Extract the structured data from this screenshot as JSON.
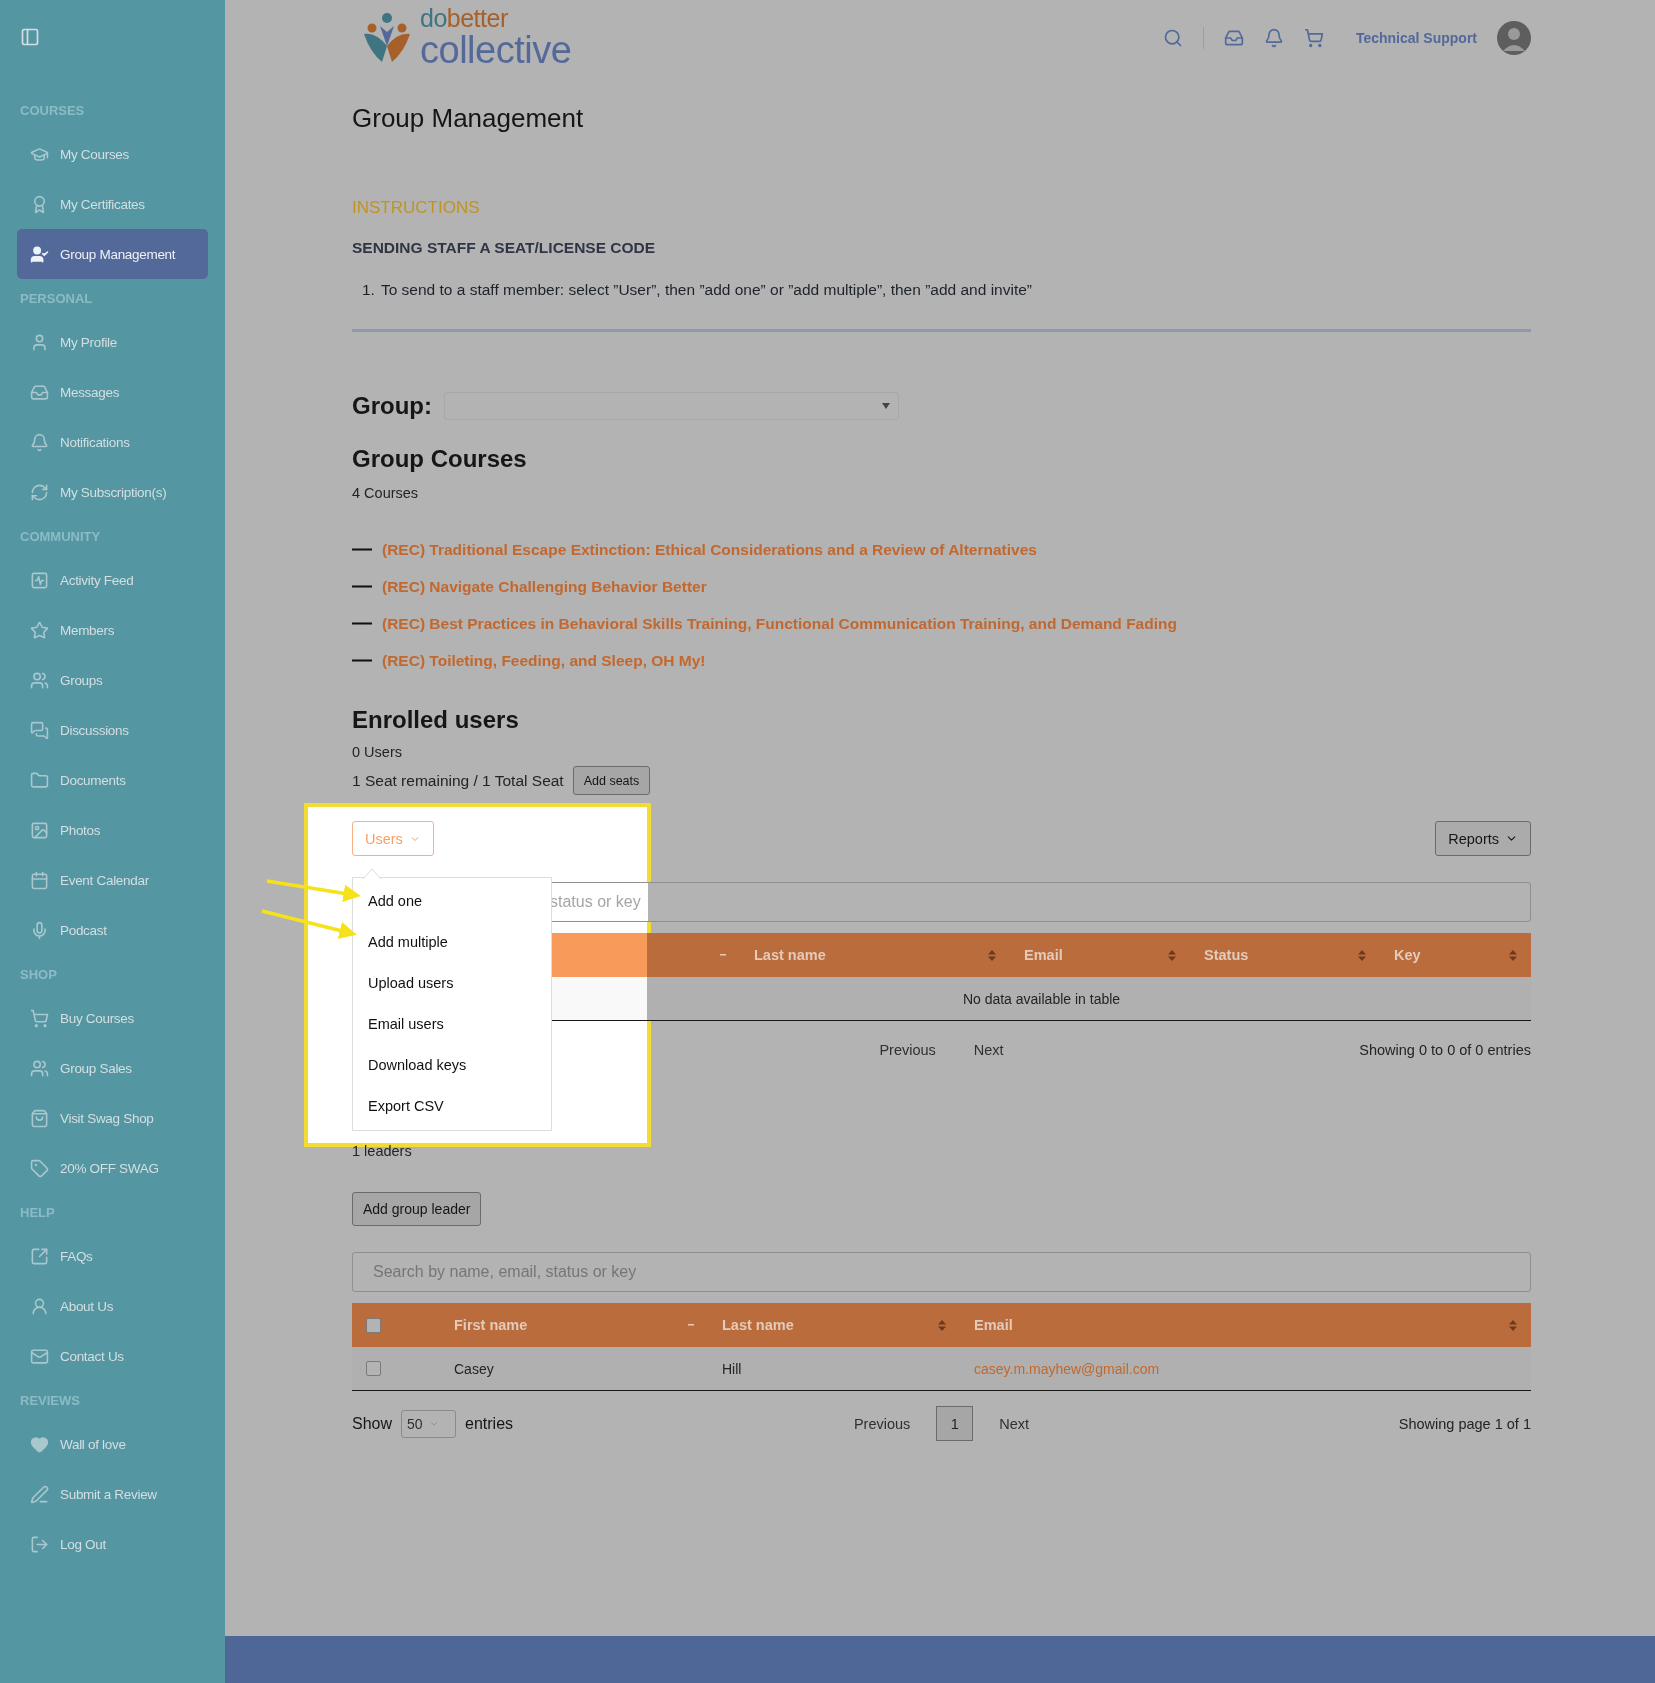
{
  "sidebar": {
    "sections": [
      {
        "title": "COURSES",
        "items": [
          {
            "label": "My Courses",
            "selected": false
          },
          {
            "label": "My Certificates",
            "selected": false
          },
          {
            "label": "Group Management",
            "selected": true
          }
        ]
      },
      {
        "title": "PERSONAL",
        "items": [
          {
            "label": "My Profile",
            "selected": false
          },
          {
            "label": "Messages",
            "selected": false
          },
          {
            "label": "Notifications",
            "selected": false
          },
          {
            "label": "My Subscription(s)",
            "selected": false
          }
        ]
      },
      {
        "title": "COMMUNITY",
        "items": [
          {
            "label": "Activity Feed",
            "selected": false
          },
          {
            "label": "Members",
            "selected": false
          },
          {
            "label": "Groups",
            "selected": false
          },
          {
            "label": "Discussions",
            "selected": false
          },
          {
            "label": "Documents",
            "selected": false
          },
          {
            "label": "Photos",
            "selected": false
          },
          {
            "label": "Event Calendar",
            "selected": false
          },
          {
            "label": "Podcast",
            "selected": false
          }
        ]
      },
      {
        "title": "SHOP",
        "items": [
          {
            "label": "Buy Courses",
            "selected": false
          },
          {
            "label": "Group Sales",
            "selected": false
          },
          {
            "label": "Visit Swag Shop",
            "selected": false
          },
          {
            "label": "20% OFF SWAG",
            "selected": false
          }
        ]
      },
      {
        "title": "HELP",
        "items": [
          {
            "label": "FAQs",
            "selected": false
          },
          {
            "label": "About Us",
            "selected": false
          },
          {
            "label": "Contact Us",
            "selected": false
          }
        ]
      },
      {
        "title": "REVIEWS",
        "items": [
          {
            "label": "Wall of love",
            "selected": false
          },
          {
            "label": "Submit a Review",
            "selected": false
          },
          {
            "label": "Log Out",
            "selected": false
          }
        ]
      }
    ]
  },
  "header": {
    "logo": {
      "part_1": "do",
      "part_2": "better",
      "part_3": "collective"
    },
    "user_name": "Technical Support"
  },
  "page": {
    "title": "Group Management"
  },
  "instructions": {
    "heading": "INSTRUCTIONS",
    "subheading": "SENDING STAFF A SEAT/LICENSE CODE",
    "steps": [
      {
        "number": "1.",
        "text": "To send to a staff member: select ”User”, then ”add one” or ”add multiple”, then ”add and invite”"
      }
    ]
  },
  "group": {
    "label": "Group:"
  },
  "group_courses": {
    "title": "Group Courses",
    "count": "4 Courses",
    "courses": [
      "(REC) Traditional Escape Extinction: Ethical Considerations and a Review of Alternatives",
      "(REC) Navigate Challenging Behavior Better",
      "(REC) Best Practices in Behavioral Skills Training, Functional Communication Training, and Demand Fading",
      "(REC) Toileting, Feeding, and Sleep, OH My!"
    ]
  },
  "enrolled_users": {
    "title": "Enrolled users",
    "count": "0 Users",
    "seats": "1 Seat remaining / 1 Total Seat",
    "add_seats_button": "Add seats",
    "users_button": {
      "label": "Users",
      "expanded": true
    },
    "users_menu": [
      "Add one",
      "Add multiple",
      "Upload users",
      "Email users",
      "Download keys",
      "Export CSV"
    ],
    "reports_button": "Reports",
    "search": {
      "placeholder": "status or key"
    },
    "table": {
      "columns": [
        {
          "sorted": true
        },
        {
          "label": "Last name",
          "sorted": false
        },
        {
          "label": "Email",
          "sorted": false
        },
        {
          "label": "Status",
          "sorted": false
        },
        {
          "label": "Key",
          "sorted": false
        }
      ],
      "empty_message": "No data available in table"
    },
    "pagination": {
      "previous": "Previous",
      "next": "Next"
    },
    "info": "Showing 0 to 0 of 0 entries"
  },
  "group_leaders": {
    "count": "1 leaders",
    "add_button": "Add group leader",
    "search": {
      "placeholder": "Search by name, email, status or key"
    },
    "table": {
      "all_checked": false,
      "columns": [
        {
          "label": "First name",
          "sorted": true
        },
        {
          "label": "Last name",
          "sorted": false
        },
        {
          "label": "Email",
          "sorted": false
        }
      ],
      "rows": [
        {
          "checked": false,
          "first_name": "Casey",
          "last_name": "Hill",
          "email": "casey.m.mayhew@gmail.com"
        }
      ]
    },
    "length": {
      "label_before": "Show",
      "value": "50",
      "label_after": "entries"
    },
    "pagination": {
      "previous": "Previous",
      "pages": [
        {
          "label": "1",
          "selected": true
        }
      ],
      "next": "Next"
    },
    "info": "Showing page 1 of 1"
  }
}
